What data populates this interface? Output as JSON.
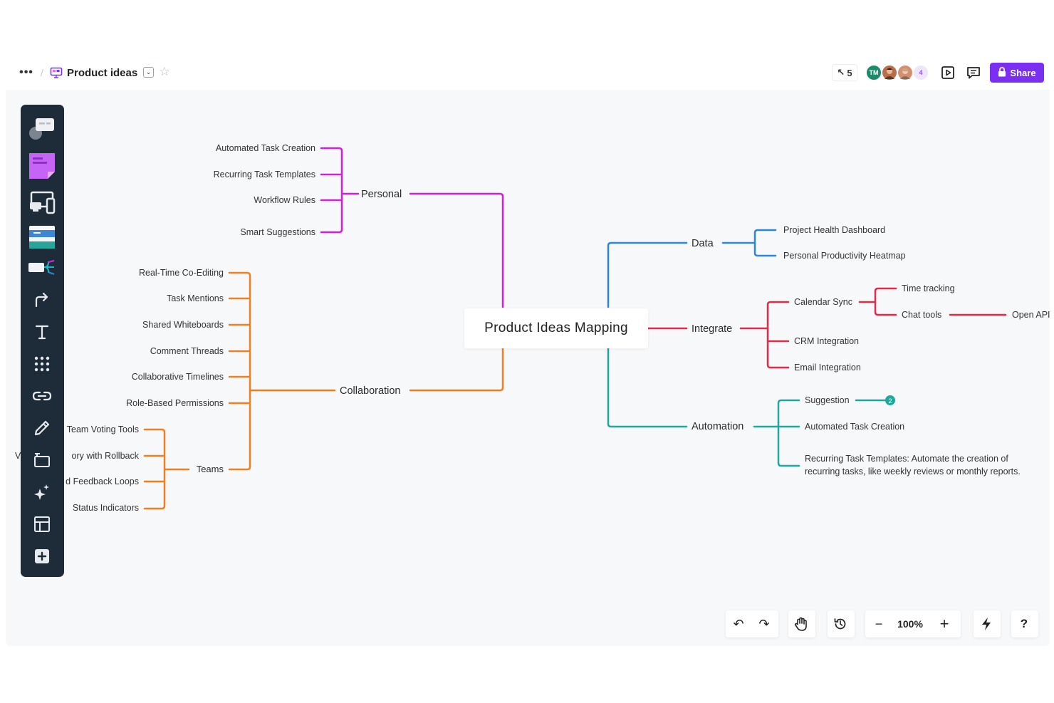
{
  "topbar": {
    "more_label": "•••",
    "separator": "/",
    "board_title": "Product ideas",
    "dropdown_glyph": "⌄",
    "star_glyph": "☆",
    "cursor_count": "5",
    "cursor_glyph": "↖",
    "avatars": [
      {
        "initials": "TM",
        "color": "#1d8a6a"
      },
      {
        "initials": "",
        "color": "#b5704b"
      },
      {
        "initials": "",
        "color": "#d28f74"
      }
    ],
    "extra_avatars": "4",
    "share_label": "Share"
  },
  "toolbar": {
    "tools": [
      {
        "name": "sticky-stack-tool",
        "icon": "sticky-stack-icon"
      },
      {
        "name": "sticky-note-tool",
        "icon": "sticky-note-icon"
      },
      {
        "name": "devices-tool",
        "icon": "devices-icon"
      },
      {
        "name": "template-tool",
        "icon": "template-icon"
      },
      {
        "name": "mindmap-tool",
        "icon": "mindmap-icon"
      },
      {
        "name": "connector-tool",
        "icon": "arrow-icon"
      },
      {
        "name": "text-tool",
        "icon": "text-icon"
      },
      {
        "name": "grid-tool",
        "icon": "grid-icon"
      },
      {
        "name": "link-tool",
        "icon": "link-icon"
      },
      {
        "name": "pen-tool",
        "icon": "pen-icon"
      },
      {
        "name": "frame-tool",
        "icon": "frame-icon"
      },
      {
        "name": "ai-tool",
        "icon": "sparkle-icon"
      },
      {
        "name": "layout-tool",
        "icon": "layout-icon"
      },
      {
        "name": "add-tool",
        "icon": "plus-square-icon"
      }
    ]
  },
  "mindmap": {
    "center": "Product Ideas Mapping",
    "colors": {
      "personal": "#d21fd8",
      "collaboration": "#f07f22",
      "data": "#2f86d8",
      "integrate": "#e02b4b",
      "automation": "#1fa89c"
    },
    "branches": {
      "personal": {
        "label": "Personal",
        "children": [
          "Automated Task Creation",
          "Recurring Task Templates",
          "Workflow Rules",
          "Smart Suggestions"
        ]
      },
      "collaboration": {
        "label": "Collaboration",
        "children": [
          "Real-Time Co-Editing",
          "Task Mentions",
          "Shared Whiteboards",
          "Comment Threads",
          "Collaborative Timelines",
          "Role-Based Permissions"
        ],
        "teams": {
          "label": "Teams",
          "children": [
            "Team Voting Tools",
            "ory with Rollback",
            "d Feedback Loops",
            "Status Indicators"
          ],
          "clipped_prefix": "V"
        }
      },
      "data": {
        "label": "Data",
        "children": [
          "Project Health Dashboard",
          "Personal Productivity Heatmap"
        ]
      },
      "integrate": {
        "label": "Integrate",
        "calendar_sync": {
          "label": "Calendar Sync",
          "children": [
            "Time tracking",
            "Chat tools"
          ],
          "chat_child": "Open API"
        },
        "children": [
          "CRM Integration",
          "Email Integration"
        ]
      },
      "automation": {
        "label": "Automation",
        "suggestion": "Suggestion",
        "suggestion_badge": "2",
        "children": [
          "Automated Task Creation"
        ],
        "recurring_line1": "Recurring Task Templates: Automate the creation of",
        "recurring_line2": "recurring tasks, like weekly reviews or monthly reports."
      }
    }
  },
  "bottom": {
    "undo": "↶",
    "redo": "↷",
    "zoom_out": "−",
    "zoom_level": "100%",
    "zoom_in": "+",
    "help": "?"
  }
}
